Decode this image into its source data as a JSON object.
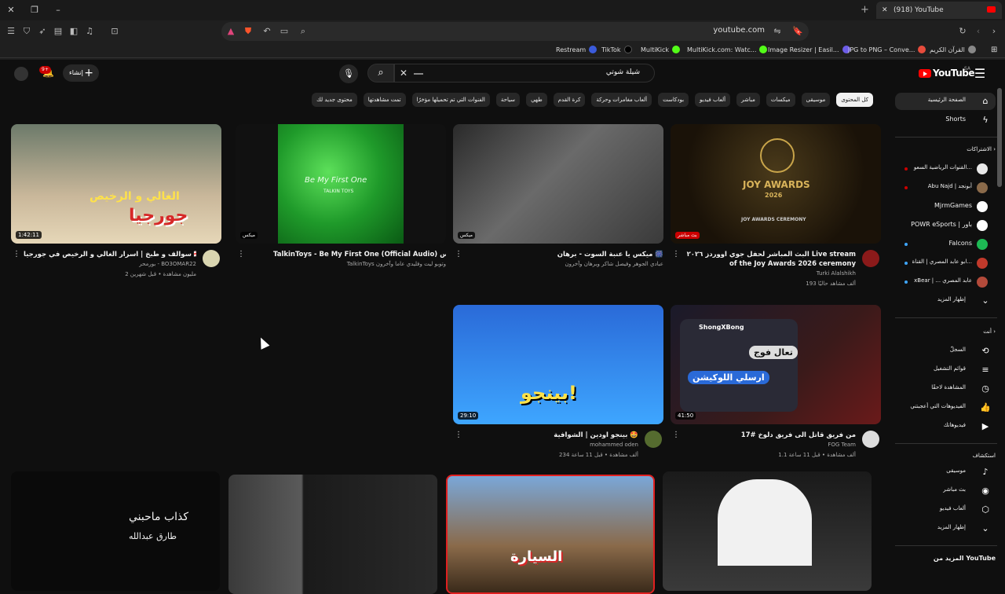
{
  "browser": {
    "tab_title": "(918) YouTube",
    "url": "youtube.com",
    "bookmarks": [
      "Restream",
      "TikTok",
      "MultiKick",
      "MultiKick.com: Watc...",
      "Image Resizer | Easil...",
      "JPG to PNG – Conve...",
      "القرآن الكريم"
    ]
  },
  "header": {
    "logo": "YouTube",
    "country_code": "SA",
    "search_value": "شيلة شوتي",
    "create_label": "إنشاء",
    "notifications_badge": "9+"
  },
  "chips": [
    "كل المحتوى",
    "موسيقى",
    "ميكسات",
    "مباشر",
    "ألعاب فيديو",
    "بودكاست",
    "ألعاب مغامرات وحركة",
    "كرة القدم",
    "طهي",
    "سياحة",
    "الفنوات التي تم تحميلها مؤخرًا",
    "تمت مشاهدتها",
    "محتوى جديد لك"
  ],
  "sidebar": {
    "home": "الصفحة الرئيسية",
    "shorts": "Shorts",
    "subscriptions_heading": "الاشتراكات",
    "subscriptions": [
      {
        "name": "القنوات الرياضية السعو...",
        "color": "#e8e8e8"
      },
      {
        "name": "Abu Najd | أبونجد",
        "color": "#8a6a4a"
      },
      {
        "name": "MjrmGames",
        "color": "#ffffff"
      },
      {
        "name": "POWR eSports | باور",
        "color": "#ffffff"
      },
      {
        "name": "Falcons",
        "color": "#1db954"
      },
      {
        "name": "ابو عابد المصري | القناة...",
        "color": "#c0392b"
      },
      {
        "name": "xBear | ... عابد المصري",
        "color": "#b34a3a"
      }
    ],
    "show_more": "إظهار المزيد",
    "you_heading": "أنت",
    "you_items": [
      {
        "label": "السجلّ",
        "icon": "history-icon"
      },
      {
        "label": "قوائم التشغيل",
        "icon": "playlist-icon"
      },
      {
        "label": "المشاهدة لاحقًا",
        "icon": "watch-later-icon"
      },
      {
        "label": "الفيديوهات التي أعجبتني",
        "icon": "like-icon"
      },
      {
        "label": "فيديوهاتك",
        "icon": "your-videos-icon"
      }
    ],
    "explore_heading": "استكشاف",
    "explore_items": [
      {
        "label": "موسيقى",
        "icon": "music-icon"
      },
      {
        "label": "بث مباشر",
        "icon": "live-icon"
      },
      {
        "label": "ألعاب فيديو",
        "icon": "gaming-icon"
      }
    ],
    "show_more_2": "إظهار المزيد",
    "more_from": "المزيد من YouTube"
  },
  "videos": [
    {
      "title": "سوالف و طبخ | اسرار الغالي و الرخيص في جورجيا 🇬🇪 GE",
      "channel": "بورمحر - BO3OMAR22",
      "meta": "2 مليون مشاهدة • قبل شهرين",
      "duration": "1:42:11",
      "thumb_text": "جورجيا",
      "thumb_text2": "الغالي و الرخيص"
    },
    {
      "title": "TalkinToys - Be My First One (Official Audio) ميكس",
      "channel": "TalkinToys وتوبو ليت وفليدي عاما وآخرون",
      "meta": "",
      "badge": "ميكس",
      "thumb_text": "Be My First One",
      "thumb_text2": "TALKIN TOYS"
    },
    {
      "title": "ميكس يا عنبة السوت - برهان 🎆",
      "channel": "عبادي الجوهر وفيصل شاكر وبرهان وآخرون",
      "meta": "",
      "badge": "ميكس"
    },
    {
      "title": "البث المباشر لحفل جوي اووردز ٢٠٢٦ Live stream of the Joy Awards 2026 ceremony",
      "channel": "Turki Alalshikh",
      "meta": "193 ألف مشاهد حاليًا",
      "badge": "بث مباشر",
      "thumb_text": "JOY AWARDS",
      "thumb_text2": "2026",
      "thumb_text3": "JOY AWARDS CEREMONY"
    },
    {
      "title": "بينجو اودين | الشوافية 🤩",
      "channel": "mohammed oden",
      "meta": "234 ألف مشاهدة • قبل 11 ساعة",
      "duration": "29:10",
      "thumb_text": "بينجو!"
    },
    {
      "title": "من فريق قاتل الى فريق دلوخ #17",
      "channel": "FOG Team",
      "meta": "1.1 ألف مشاهدة • قبل 11 ساعة",
      "duration": "41:50",
      "thumb_text": "ShongXBong",
      "thumb_text2": "تعال فوج",
      "thumb_text3": "ارسلي اللوكيشن"
    },
    {
      "title": "",
      "channel": "",
      "meta": "",
      "thumb_text": "كذاب ماحبني",
      "thumb_text2": "طارق عبدالله"
    },
    {
      "title": "",
      "channel": "",
      "meta": ""
    },
    {
      "title": "",
      "channel": "",
      "meta": "",
      "thumb_text": "السيارة"
    },
    {
      "title": "",
      "channel": "",
      "meta": ""
    }
  ],
  "colors": {
    "accent": "#ff0000",
    "background": "#0f0f0f",
    "chip": "#272727"
  }
}
